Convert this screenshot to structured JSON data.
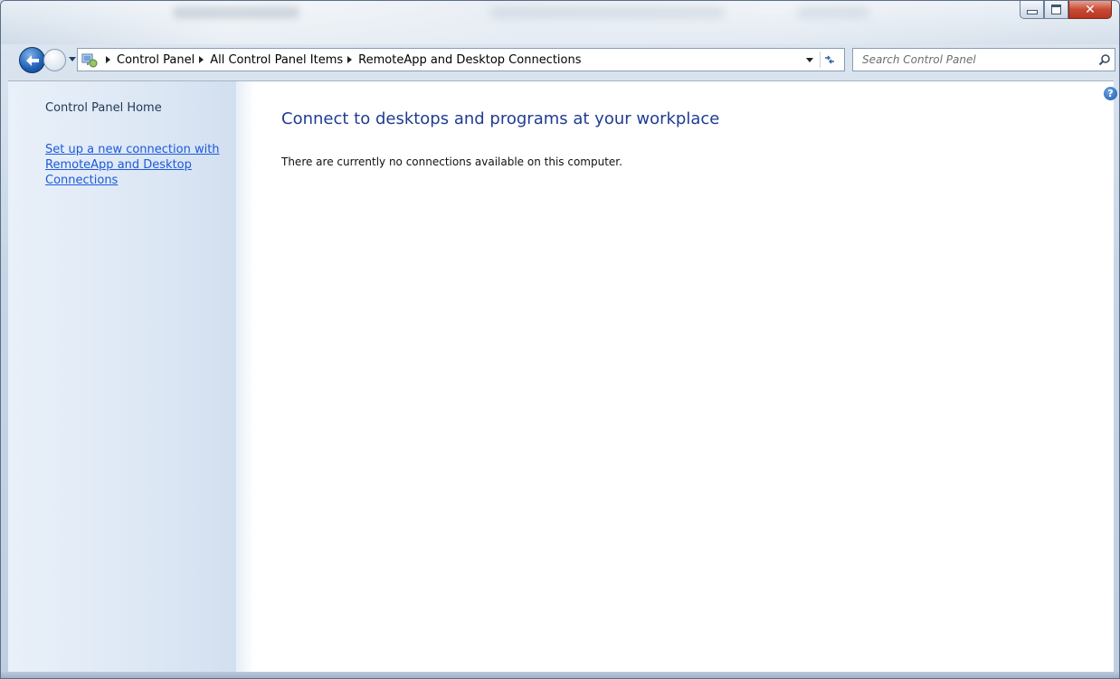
{
  "window": {
    "caption_buttons": {
      "minimize": "",
      "maximize": "",
      "close": "✕"
    }
  },
  "nav": {
    "breadcrumbs": [
      "Control Panel",
      "All Control Panel Items",
      "RemoteApp and Desktop Connections"
    ],
    "search_placeholder": "Search Control Panel"
  },
  "sidebar": {
    "home_label": "Control Panel Home",
    "link_label": "Set up a new connection with RemoteApp and Desktop Connections"
  },
  "main": {
    "title": "Connect to desktops and programs at your workplace",
    "message": "There are currently no connections available on this computer."
  },
  "help_glyph": "?",
  "colors": {
    "link": "#1c5adb",
    "title": "#1f3c93",
    "close_button": "#c74a35"
  },
  "icons": [
    "back-arrow-icon",
    "forward-arrow-icon",
    "control-panel-icon",
    "refresh-icon",
    "search-icon",
    "help-icon"
  ]
}
